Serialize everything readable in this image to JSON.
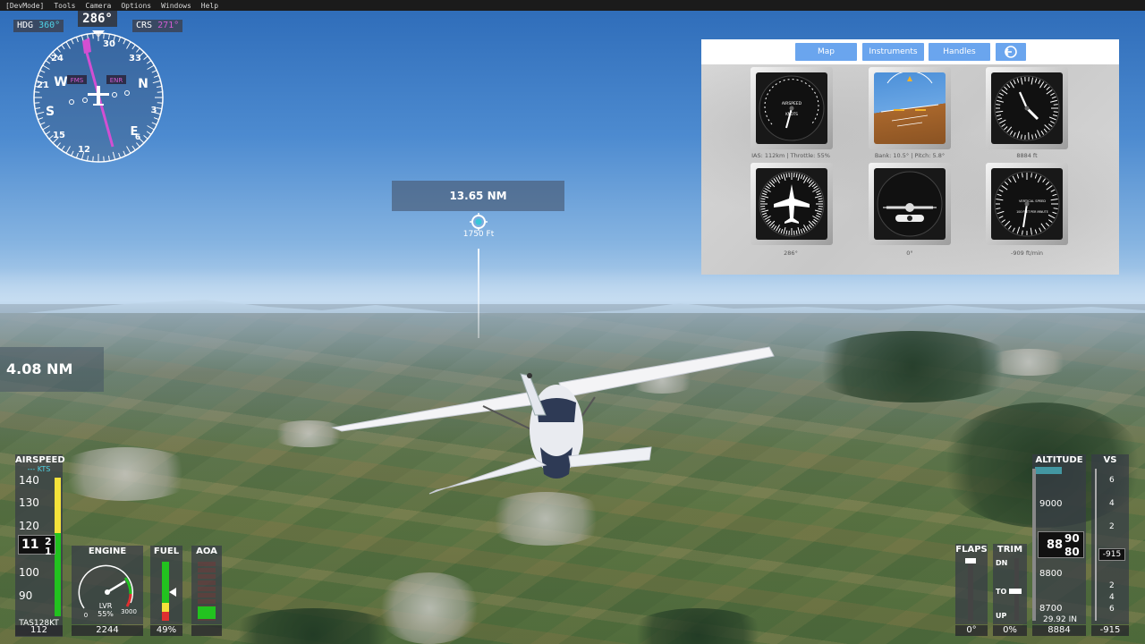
{
  "menu": [
    "[DevMode]",
    "Tools",
    "Camera",
    "Options",
    "Windows",
    "Help"
  ],
  "compass": {
    "heading_readout": "286°",
    "hdg_label": "HDG",
    "hdg_value": "360°",
    "crs_label": "CRS",
    "crs_value": "271°",
    "fms_label": "FMS",
    "enr_label": "ENR",
    "ticks": [
      "24",
      "30",
      "33",
      "N",
      "3",
      "E",
      "S",
      "W",
      "21",
      "15",
      "12",
      "6"
    ]
  },
  "waypoint": {
    "distance": "13.65 NM",
    "altitude": "1750 Ft"
  },
  "left_distance": "4.08 NM",
  "panel": {
    "tabs": [
      "Map",
      "Instruments",
      "Handles"
    ],
    "captions": [
      "IAS: 112km | Throttle: 55%",
      "Bank: 10.5° | Pitch: 5.8°",
      "8884 ft",
      "286°",
      "0°",
      "-909 ft/min"
    ],
    "airspeed_face": {
      "title": "AIRSPEED",
      "unit": "KNOTS"
    },
    "vsi_face": {
      "title": "VERTICAL SPEED",
      "unit": "100 FEET PER MINUTE"
    }
  },
  "airspeed": {
    "label": "AIRSPEED",
    "unit": "--- KTS",
    "ticks": [
      "140",
      "130",
      "120",
      "100",
      "90"
    ],
    "current_main": "11",
    "current_roll_top": "2",
    "current_roll_bot": "1",
    "tas_label": "TAS",
    "tas_value": "128KT",
    "bottom_value": "112"
  },
  "engine": {
    "label": "ENGINE",
    "lvr": "LVR",
    "pct": "55%",
    "min": "0",
    "max": "3000",
    "value": "2244",
    "fraction": 0.745
  },
  "fuel": {
    "label": "FUEL",
    "value": "49%",
    "fraction": 0.49
  },
  "aoa": {
    "label": "AOA"
  },
  "flaps": {
    "label": "FLAPS",
    "value": "0°"
  },
  "trim": {
    "label": "TRIM",
    "dn": "DN",
    "to": "TO",
    "up": "UP",
    "value": "0%"
  },
  "altitude": {
    "label": "ALTITUDE",
    "ticks": [
      "9000",
      "8800",
      "8700"
    ],
    "current_main": "88",
    "roll_top": "90",
    "roll_bot": "80",
    "baro": "29.92 IN",
    "bottom_value": "8884"
  },
  "vs": {
    "label": "VS",
    "ticks": [
      "6",
      "4",
      "2",
      "2",
      "4",
      "6"
    ],
    "current": "-915",
    "bottom_value": "-915"
  },
  "colors": {
    "hud_cyan": "#4fd3e6",
    "hud_magenta": "#d45bd4",
    "tab_blue": "#6aa5ee",
    "green": "#22c21f",
    "yellow": "#f4e23a"
  }
}
